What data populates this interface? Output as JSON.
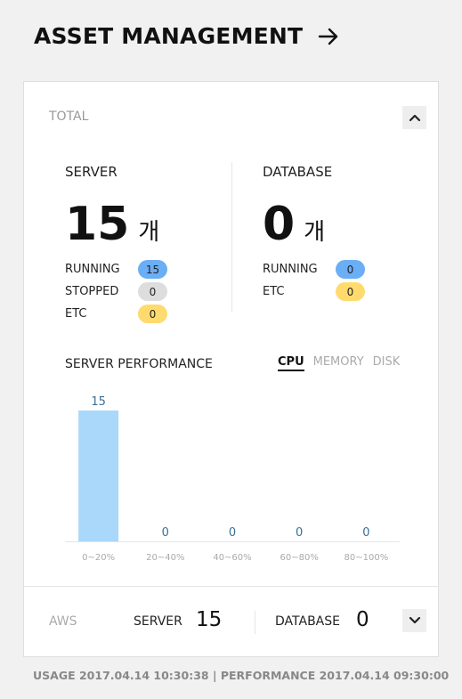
{
  "header": {
    "title": "ASSET MANAGEMENT",
    "arrow_icon": "arrow-right-icon"
  },
  "total": {
    "label": "TOTAL"
  },
  "server": {
    "title": "SERVER",
    "count": "15",
    "unit": "개",
    "rows": [
      {
        "label": "RUNNING",
        "value": "15",
        "color": "#6aaef5"
      },
      {
        "label": "STOPPED",
        "value": "0",
        "color": "#dddddd"
      },
      {
        "label": "ETC",
        "value": "0",
        "color": "#ffdb6e"
      }
    ]
  },
  "database": {
    "title": "DATABASE",
    "count": "0",
    "unit": "개",
    "rows": [
      {
        "label": "RUNNING",
        "value": "0",
        "color": "#6aaef5"
      },
      {
        "label": "ETC",
        "value": "0",
        "color": "#ffdb6e"
      }
    ]
  },
  "performance": {
    "title": "SERVER PERFORMANCE",
    "tabs": [
      "CPU",
      "MEMORY",
      "DISK"
    ],
    "active_tab": "CPU"
  },
  "chart_data": {
    "type": "bar",
    "categories": [
      "0~20%",
      "20~40%",
      "40~60%",
      "60~80%",
      "80~100%"
    ],
    "values": [
      15,
      0,
      0,
      0,
      0
    ],
    "ylim": [
      0,
      15
    ],
    "bar_color": "#a9d8fb",
    "label_color": "#3a6f97",
    "title": "",
    "xlabel": "",
    "ylabel": ""
  },
  "aws": {
    "label": "AWS",
    "server_label": "SERVER",
    "server_value": "15",
    "database_label": "DATABASE",
    "database_value": "0"
  },
  "footer": {
    "text": "USAGE 2017.04.14 10:30:38 | PERFORMANCE 2017.04.14 09:30:00"
  }
}
